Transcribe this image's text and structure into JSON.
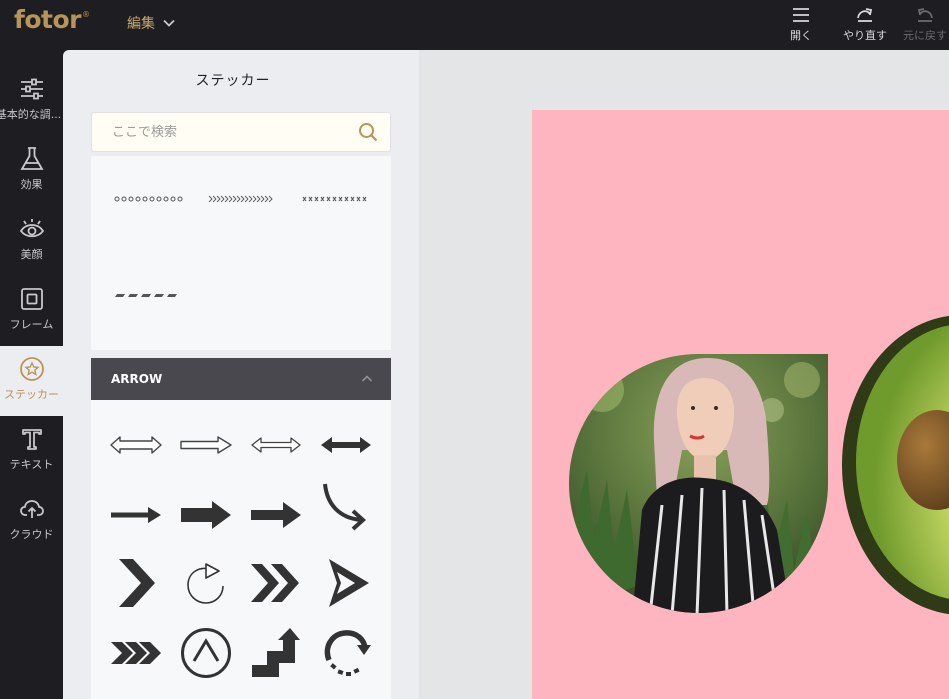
{
  "topbar": {
    "logo": "fotor",
    "logo_mark": "®",
    "edit_label": "編集",
    "open_label": "開く",
    "redo_label": "やり直す",
    "revert_label": "元に戻す"
  },
  "nav": {
    "items": [
      {
        "label": "基本的な調..."
      },
      {
        "label": "効果"
      },
      {
        "label": "美顔"
      },
      {
        "label": "フレーム"
      },
      {
        "label": "ステッカー"
      },
      {
        "label": "テキスト"
      },
      {
        "label": "クラウド"
      }
    ]
  },
  "panel": {
    "title": "ステッカー",
    "search_placeholder": "ここで検索",
    "category": "ARROW"
  },
  "colors": {
    "accent": "#b7955a",
    "topbar_bg": "#1d1d22",
    "panel_bg": "#ecedf1",
    "card_bg": "#ffb5bf",
    "category_bg": "#48484e"
  }
}
